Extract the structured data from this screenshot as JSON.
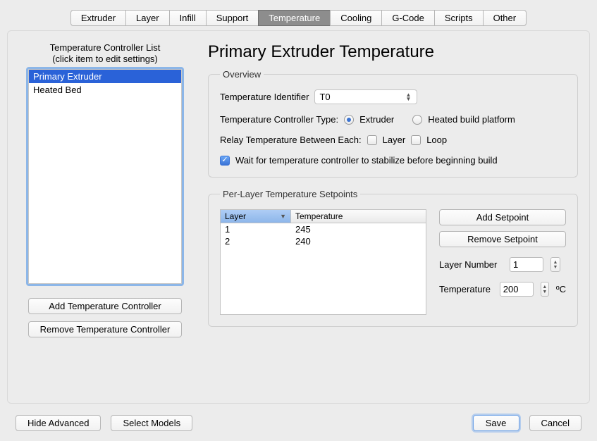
{
  "tabs": [
    "Extruder",
    "Layer",
    "Infill",
    "Support",
    "Temperature",
    "Cooling",
    "G-Code",
    "Scripts",
    "Other"
  ],
  "active_tab": "Temperature",
  "left": {
    "title_line1": "Temperature Controller List",
    "title_line2": "(click item to edit settings)",
    "items": [
      "Primary Extruder",
      "Heated Bed"
    ],
    "selected": "Primary Extruder",
    "add_btn": "Add Temperature Controller",
    "remove_btn": "Remove Temperature Controller"
  },
  "main": {
    "title": "Primary Extruder Temperature",
    "overview": {
      "legend": "Overview",
      "identifier_label": "Temperature Identifier",
      "identifier_value": "T0",
      "type_label": "Temperature Controller Type:",
      "type_options": {
        "extruder": "Extruder",
        "heated_bed": "Heated build platform"
      },
      "type_selected": "extruder",
      "relay_label": "Relay Temperature Between Each:",
      "relay_layer": "Layer",
      "relay_loop": "Loop",
      "relay_layer_checked": false,
      "relay_loop_checked": false,
      "wait_checked": true,
      "wait_label": "Wait for temperature controller to stabilize before beginning build"
    },
    "setpoints": {
      "legend": "Per-Layer Temperature Setpoints",
      "headers": {
        "layer": "Layer",
        "temperature": "Temperature"
      },
      "rows": [
        {
          "layer": "1",
          "temperature": "245"
        },
        {
          "layer": "2",
          "temperature": "240"
        }
      ],
      "add_btn": "Add Setpoint",
      "remove_btn": "Remove Setpoint",
      "layer_number_label": "Layer Number",
      "layer_number_value": "1",
      "temperature_label": "Temperature",
      "temperature_value": "200",
      "temperature_unit": "ºC"
    }
  },
  "footer": {
    "hide_advanced": "Hide Advanced",
    "select_models": "Select Models",
    "save": "Save",
    "cancel": "Cancel"
  }
}
